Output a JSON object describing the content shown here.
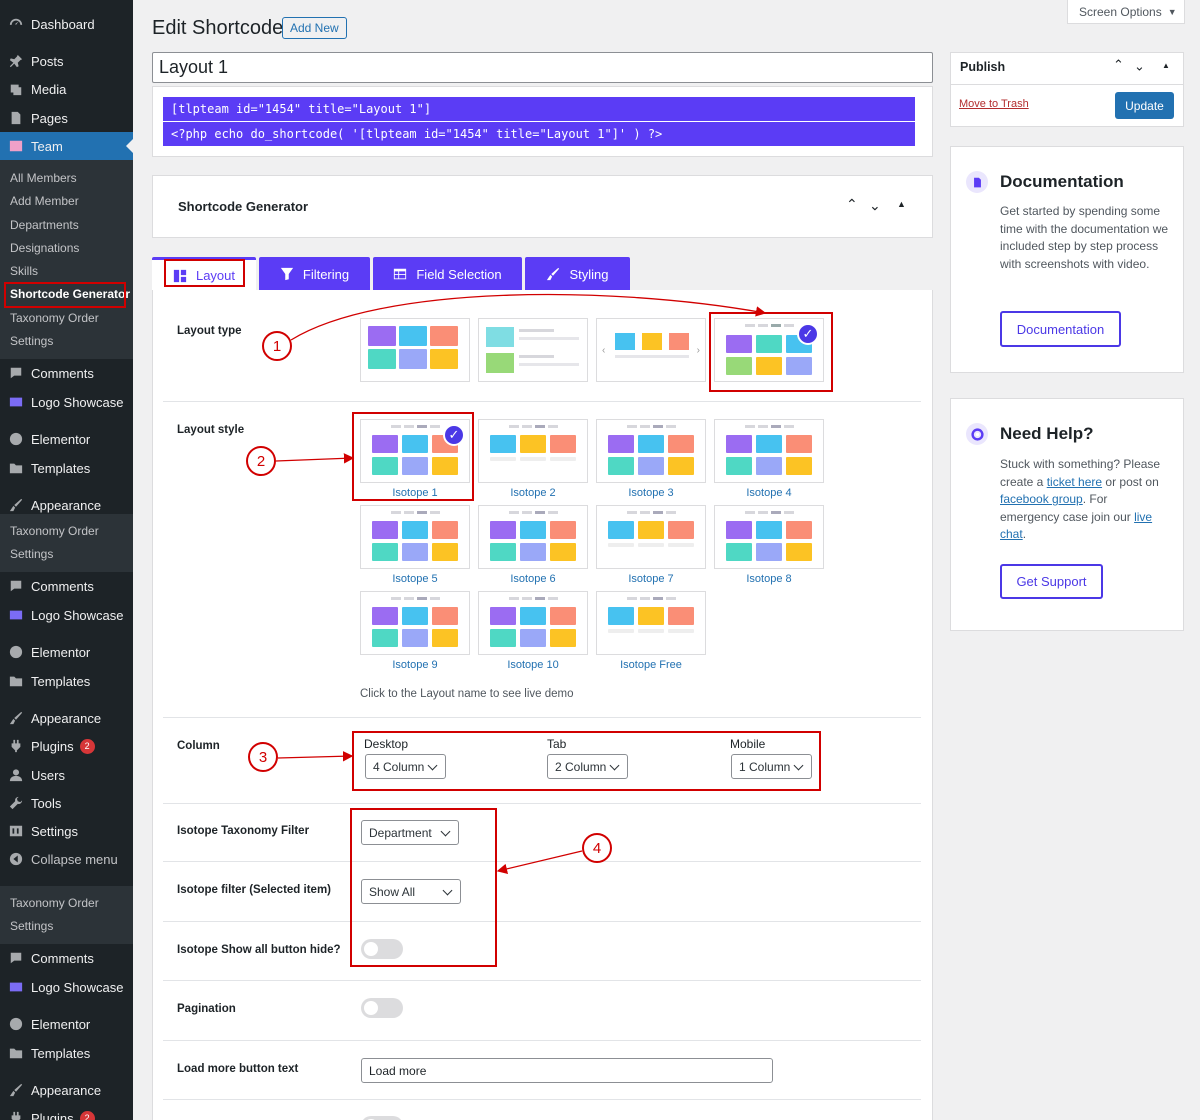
{
  "menu": {
    "dashboard": "Dashboard",
    "posts": "Posts",
    "media": "Media",
    "pages": "Pages",
    "team": "Team",
    "team_sub": [
      "All Members",
      "Add Member",
      "Departments",
      "Designations",
      "Skills",
      "Shortcode Generator",
      "Taxonomy Order",
      "Settings"
    ],
    "comments": "Comments",
    "logo_showcase": "Logo Showcase",
    "elementor": "Elementor",
    "templates": "Templates",
    "appearance": "Appearance",
    "taxonomy_order": "Taxonomy Order",
    "settings": "Settings",
    "plugins": "Plugins",
    "plugins_badge": "2",
    "users": "Users",
    "tools": "Tools",
    "collapse": "Collapse menu"
  },
  "header": {
    "title": "Edit Shortcode",
    "add_new": "Add New",
    "screen_options": "Screen Options"
  },
  "post": {
    "title_value": "Layout 1",
    "shortcode1": "[tlpteam id=\"1454\" title=\"Layout 1\"]",
    "shortcode2": "<?php echo do_shortcode( '[tlpteam id=\"1454\" title=\"Layout 1\"]' ) ?>"
  },
  "generator": {
    "heading": "Shortcode Generator",
    "tabs": [
      "Layout",
      "Filtering",
      "Field Selection",
      "Styling"
    ]
  },
  "layout": {
    "layout_type_label": "Layout type",
    "layout_style_label": "Layout style",
    "styles": [
      "Isotope 1",
      "Isotope 2",
      "Isotope 3",
      "Isotope 4",
      "Isotope 5",
      "Isotope 6",
      "Isotope 7",
      "Isotope 8",
      "Isotope 9",
      "Isotope 10",
      "Isotope Free"
    ],
    "demo_hint": "Click to the Layout name to see live demo",
    "column_label": "Column",
    "desktop_label": "Desktop",
    "desktop_value": "4 Column",
    "tab_label": "Tab",
    "tab_value": "2 Column",
    "mobile_label": "Mobile",
    "mobile_value": "1 Column",
    "taxonomy_filter_label": "Isotope Taxonomy Filter",
    "taxonomy_filter_value": "Department",
    "filter_selected_label": "Isotope filter (Selected item)",
    "filter_selected_value": "Show All",
    "show_all_hide_label": "Isotope Show all button hide?",
    "show_all_hide_on": false,
    "pagination_label": "Pagination",
    "pagination_on": false,
    "load_more_label": "Load more button text",
    "load_more_value": "Load more"
  },
  "annotations": [
    "1",
    "2",
    "3",
    "4"
  ],
  "publish": {
    "title": "Publish",
    "trash": "Move to Trash",
    "update": "Update"
  },
  "docs": {
    "title": "Documentation",
    "text": "Get started by spending some time with the documentation we included step by step process with screenshots with video.",
    "button": "Documentation"
  },
  "help": {
    "title": "Need Help?",
    "t1": "Stuck with something? Please create a ",
    "link1": "ticket here",
    "t2": " or post on ",
    "link2": "facebook group",
    "t3": ". For emergency case join our ",
    "link3": "live chat",
    "t4": ".",
    "button": "Get Support"
  },
  "colors": {
    "accent": "#5b3cf5",
    "wp_blue": "#2271b1",
    "sidebar": "#1d2327",
    "annotation": "#d10000"
  }
}
